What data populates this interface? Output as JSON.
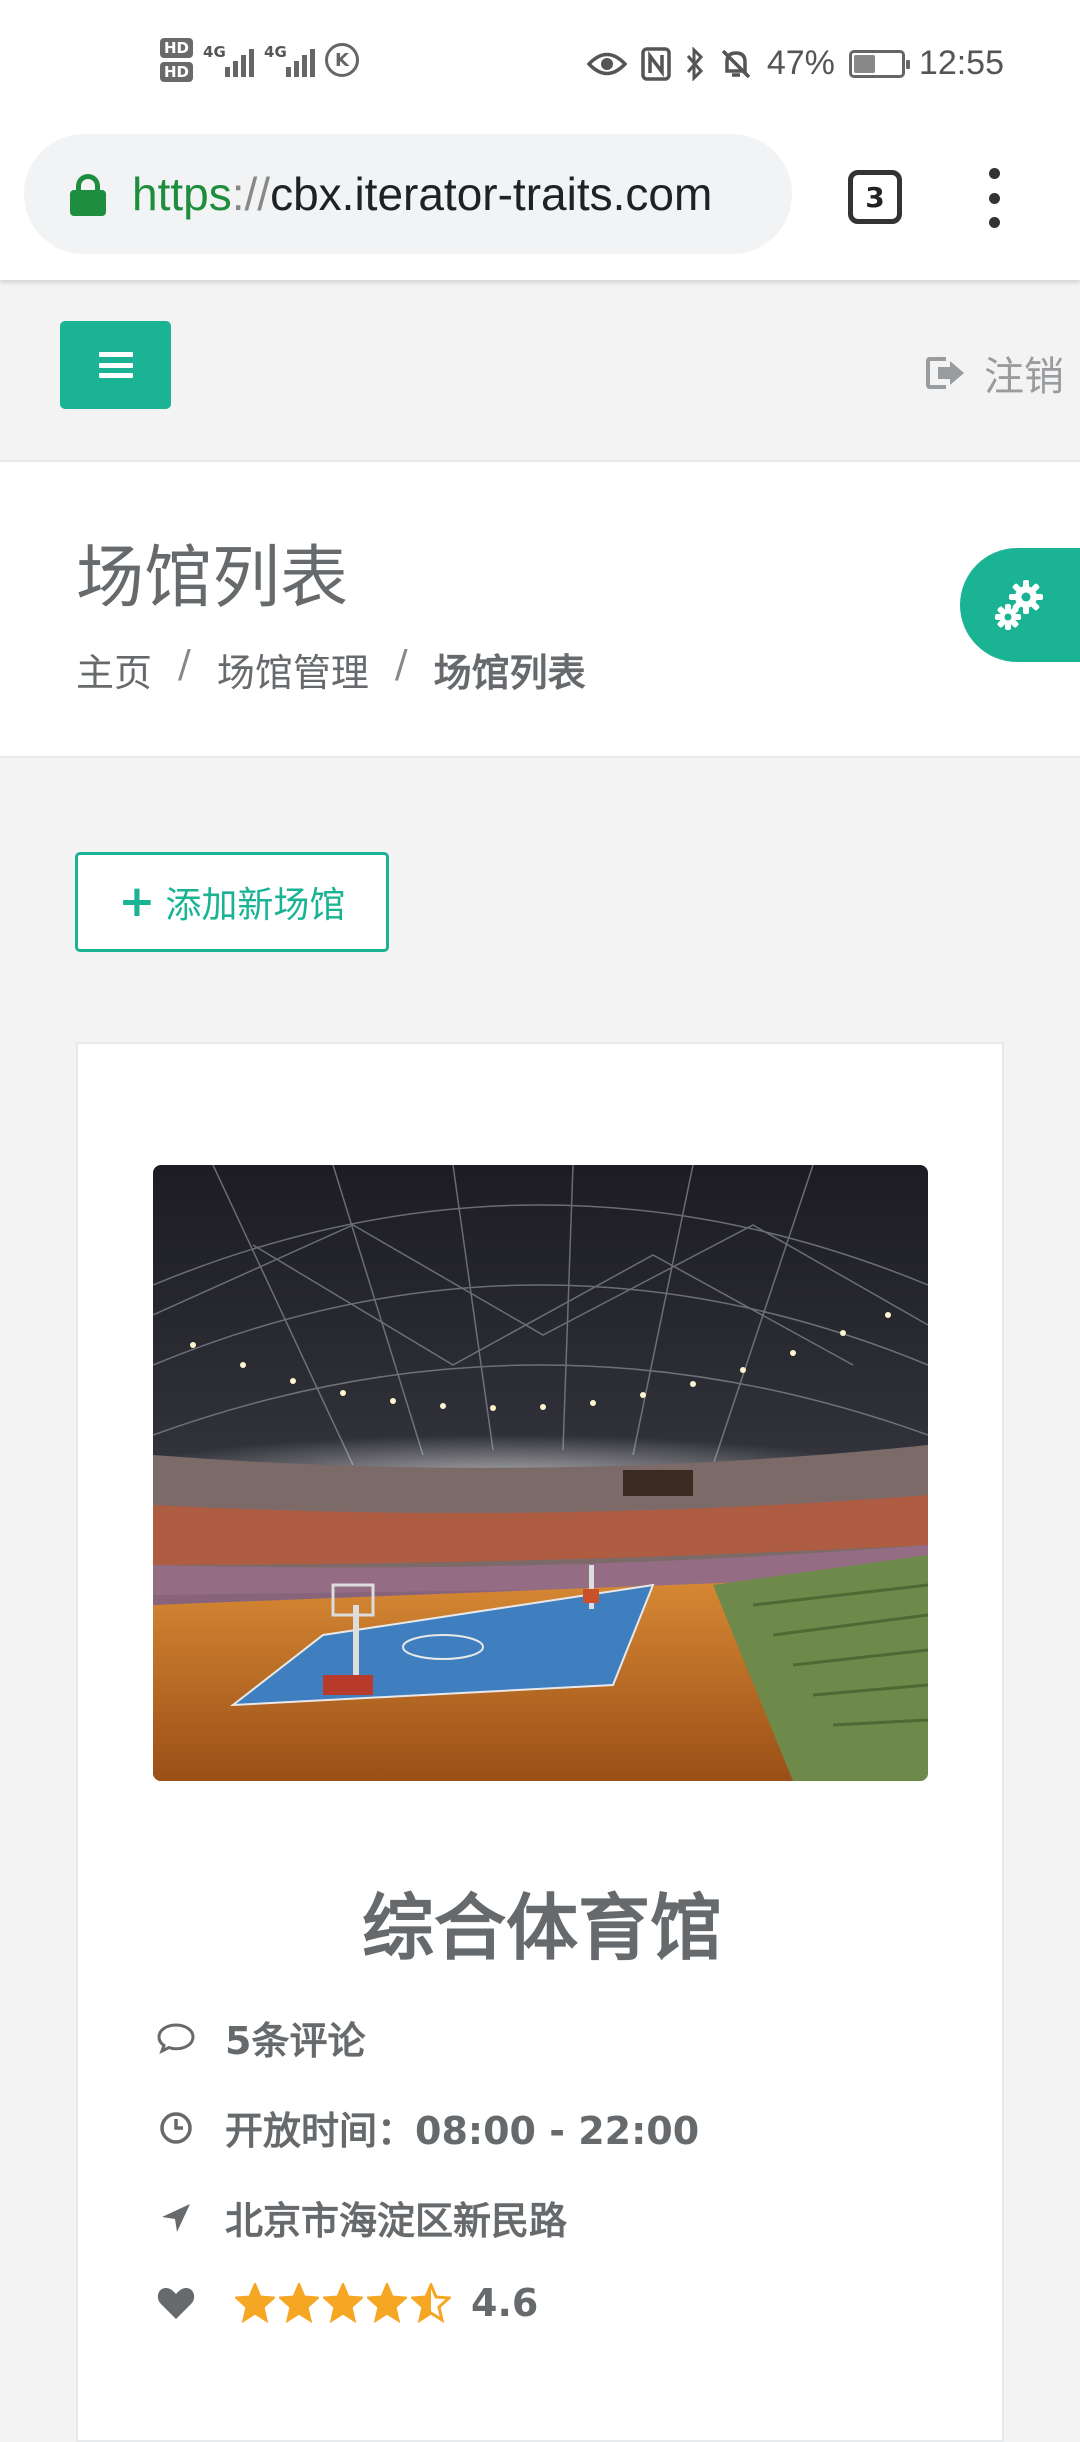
{
  "status_bar": {
    "hd1": "HD",
    "hd2": "HD",
    "net1": "4G",
    "net2": "4G",
    "battery_percent": "47%",
    "battery_level": 0.47,
    "time": "12:55"
  },
  "browser": {
    "url_scheme": "https",
    "url_sep": "://",
    "url_host": "cbx.iterator-traits.com",
    "tab_count": "3"
  },
  "nav": {
    "logout_label": "注销"
  },
  "page": {
    "title": "场馆列表",
    "breadcrumb": [
      "主页",
      "场馆管理",
      "场馆列表"
    ],
    "breadcrumb_sep": "/"
  },
  "actions": {
    "add_label": "添加新场馆"
  },
  "venue": {
    "name": "综合体育馆",
    "comments": "5条评论",
    "hours": "开放时间：08:00 - 22:00",
    "address": "北京市海淀区新民路",
    "rating": "4.6",
    "rating_value": 4.6,
    "rating_max": 5
  },
  "colors": {
    "accent": "#1ab394",
    "star": "#f5a623",
    "text": "#676a6c"
  }
}
